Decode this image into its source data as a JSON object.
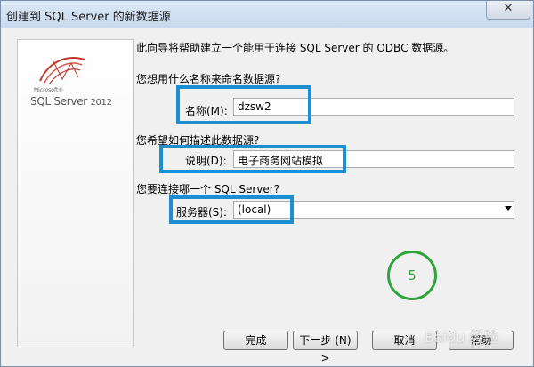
{
  "window": {
    "title": "创建到 SQL Server 的新数据源",
    "close_label": "✕"
  },
  "logo": {
    "microsoft": "Microsoft®",
    "product": "SQL Server",
    "year": "2012"
  },
  "intro_text": "此向导将帮助建立一个能用于连接 SQL Server 的 ODBC 数据源。",
  "name_question": "您想用什么名称来命名数据源?",
  "name_label": "名称(M):",
  "name_value": "dzsw2",
  "desc_question": "您希望如何描述此数据源?",
  "desc_label": "说明(D):",
  "desc_value": "电子商务网站模拟",
  "server_question": "您要连接哪一个 SQL Server?",
  "server_label": "服务器(S):",
  "server_value": "(local)",
  "step_marker": "5",
  "buttons": {
    "finish": "完成",
    "next": "下一步 (N) >",
    "cancel": "取消",
    "help": "帮助"
  },
  "watermark": "Baidu 经验",
  "colors": {
    "highlight": "#1b8fd2",
    "step_circle": "#2ea43a"
  }
}
